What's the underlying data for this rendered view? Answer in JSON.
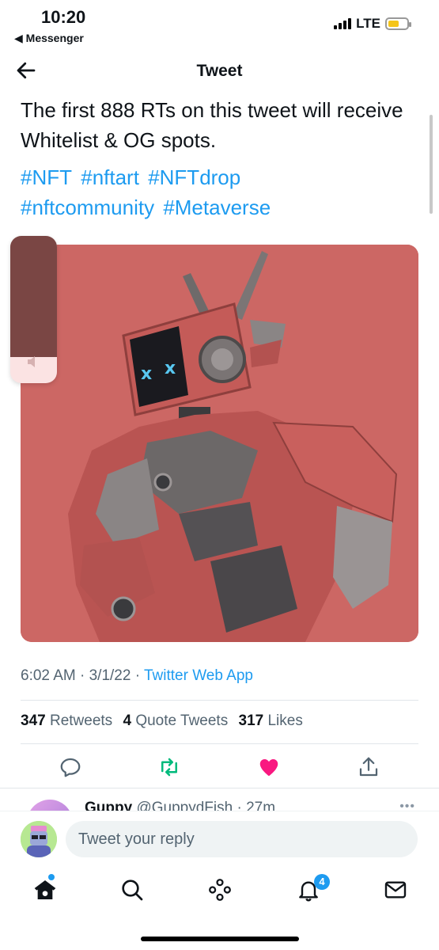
{
  "status_bar": {
    "time": "10:20",
    "back_app": "◀ Messenger",
    "network": "LTE",
    "battery_level": 0.6,
    "battery_color": "#f5c518"
  },
  "nav": {
    "title": "Tweet",
    "back_icon": "arrow-left-icon"
  },
  "tweet": {
    "text": "The first 888 RTs on this tweet will receive Whitelist & OG spots.",
    "hashtags": [
      "#NFT",
      "#nftart",
      "#NFTdrop",
      "#nftcommunity",
      "#Metaverse"
    ],
    "media_description_icon": "robot-image",
    "time": "6:02 AM",
    "date": "3/1/22",
    "source": "Twitter Web App",
    "retweets_count": "347",
    "retweets_label": "Retweets",
    "quotes_count": "4",
    "quotes_label": "Quote Tweets",
    "likes_count": "317",
    "likes_label": "Likes"
  },
  "volume_hud": {
    "level": 0.82,
    "icon": "speaker-icon"
  },
  "actions": {
    "reply_icon": "reply-icon",
    "retweet_icon": "retweet-icon",
    "like_icon": "heart-icon",
    "share_icon": "share-icon",
    "retweet_color": "#00ba7c",
    "like_color": "#f91880"
  },
  "reply_peek": {
    "name": "Guppy",
    "handle": "@GuppydFish · 27m",
    "more": "•••"
  },
  "compose": {
    "placeholder": "Tweet your reply"
  },
  "tabbar": {
    "items": [
      "home-icon",
      "search-icon",
      "spaces-icon",
      "notifications-icon",
      "messages-icon"
    ],
    "notifications_badge": "4"
  },
  "colors": {
    "accent": "#1d9bf0",
    "media_background": "#cc6764"
  }
}
